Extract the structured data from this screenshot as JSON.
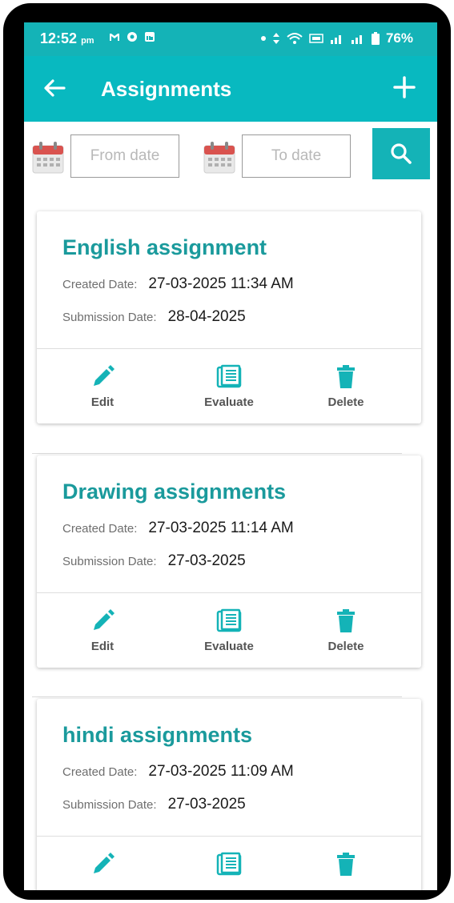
{
  "status_bar": {
    "time": "12:52",
    "ampm": "pm",
    "battery": "76%"
  },
  "app_bar": {
    "title": "Assignments"
  },
  "filter": {
    "from_placeholder": "From date",
    "to_placeholder": "To date"
  },
  "labels": {
    "created": "Created Date:",
    "submission": "Submission Date:",
    "edit": "Edit",
    "evaluate": "Evaluate",
    "delete": "Delete"
  },
  "assignments": [
    {
      "title": "English assignment",
      "created": "27-03-2025 11:34 AM",
      "submission": "28-04-2025"
    },
    {
      "title": "Drawing assignments",
      "created": "27-03-2025 11:14 AM",
      "submission": "27-03-2025"
    },
    {
      "title": "hindi assignments",
      "created": "27-03-2025 11:09 AM",
      "submission": "27-03-2025"
    }
  ],
  "colors": {
    "primary": "#08b9c0",
    "title_text": "#1a9a9c"
  },
  "icons": [
    "back-arrow-icon",
    "plus-icon",
    "calendar-icon",
    "search-icon",
    "pencil-icon",
    "document-icon",
    "trash-icon"
  ]
}
